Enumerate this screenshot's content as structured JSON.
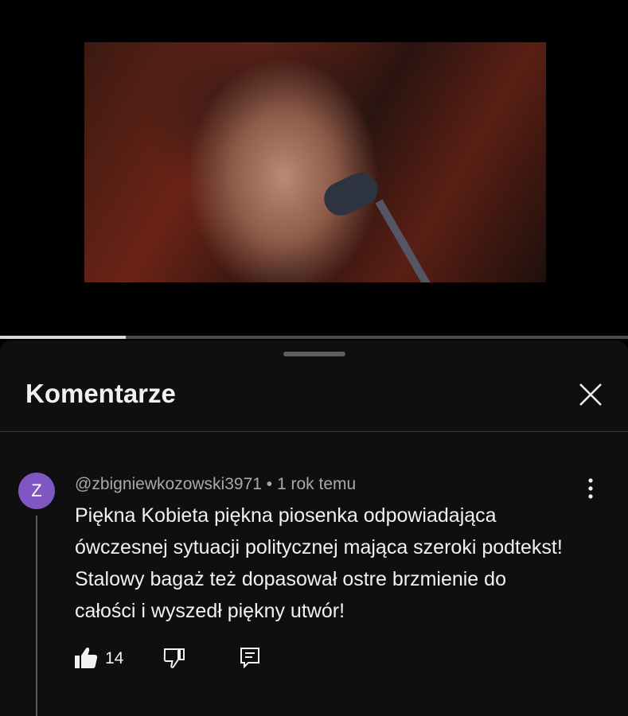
{
  "video": {
    "progress_percent": 20
  },
  "comments_panel": {
    "title": "Komentarze",
    "close_icon": "close-icon"
  },
  "comment": {
    "avatar_letter": "Z",
    "avatar_color": "#7e57c2",
    "author": "@zbigniewkozowski3971",
    "separator": "•",
    "time": "1 rok temu",
    "text": "Piękna Kobieta piękna piosenka odpowiadająca ówczesnej sytuacji politycznej mająca szeroki podtekst! Stalowy bagaż też dopasował ostre brzmienie do całości i wyszedł piękny utwór!",
    "like_count": "14",
    "icons": [
      "like-icon",
      "dislike-icon",
      "reply-icon",
      "more-vert-icon"
    ]
  }
}
